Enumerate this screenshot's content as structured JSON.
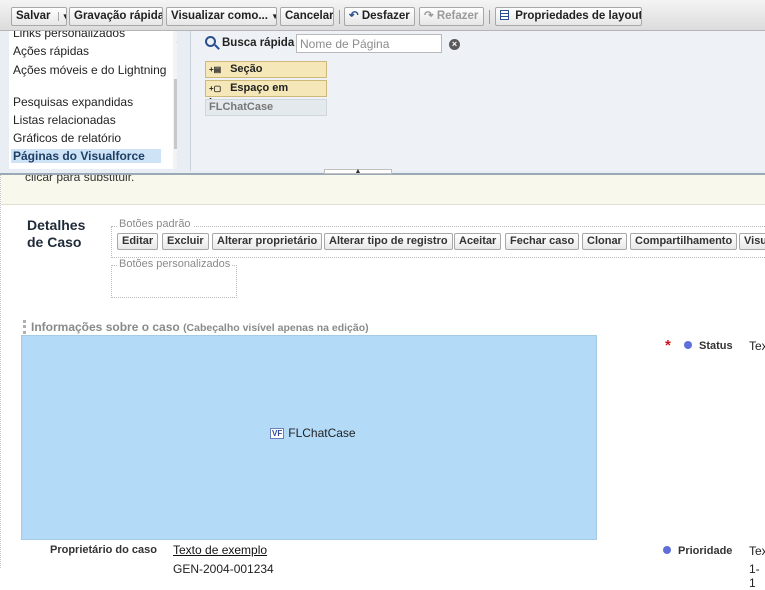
{
  "toolbar": {
    "save": "Salvar",
    "quick_save": "Gravação rápida",
    "preview_as": "Visualizar como...",
    "cancel": "Cancelar",
    "undo": "Desfazer",
    "redo": "Refazer",
    "layout_properties": "Propriedades de layout"
  },
  "palette": {
    "categories": [
      "Links personalizados",
      "Ações rápidas",
      "Ações móveis e do Lightning",
      "Pesquisas expandidas",
      "Listas relacionadas",
      "Gráficos de relatório",
      "Páginas do Visualforce"
    ],
    "selected_category": "Páginas do Visualforce",
    "quick_find_label": "Busca rápida",
    "quick_find_placeholder": "Nome de Página",
    "items": [
      "Seção",
      "Espaço em branco",
      "FLChatCase"
    ]
  },
  "layout": {
    "hint_text": "clicar para substituir.",
    "section_title_line1": "Detalhes",
    "section_title_line2": "de Caso",
    "standard_buttons_legend": "Botões padrão",
    "standard_buttons": [
      "Editar",
      "Excluir",
      "Alterar proprietário",
      "Alterar tipo de registro",
      "Aceitar",
      "Fechar caso",
      "Clonar",
      "Compartilhamento",
      "Visu"
    ],
    "custom_buttons_legend": "Botões personalizados",
    "info_section_title": "Informações sobre o caso",
    "info_section_note": "(Cabeçalho visível apenas na edição)",
    "vf_component": "FLChatCase",
    "fields": {
      "status_label": "Status",
      "status_value": "Tex",
      "owner_label": "Proprietário do caso",
      "owner_value": "Texto de exemplo",
      "priority_label": "Prioridade",
      "priority_value": "Tex",
      "cut_left_value": "GEN-2004-001234",
      "cut_right_value": "1-1"
    }
  },
  "colors": {
    "vf_block": "#b3dbf8",
    "required": "#d0141a",
    "field_dot": "#5f6fd9",
    "palette_item": "#f5e7b8"
  }
}
